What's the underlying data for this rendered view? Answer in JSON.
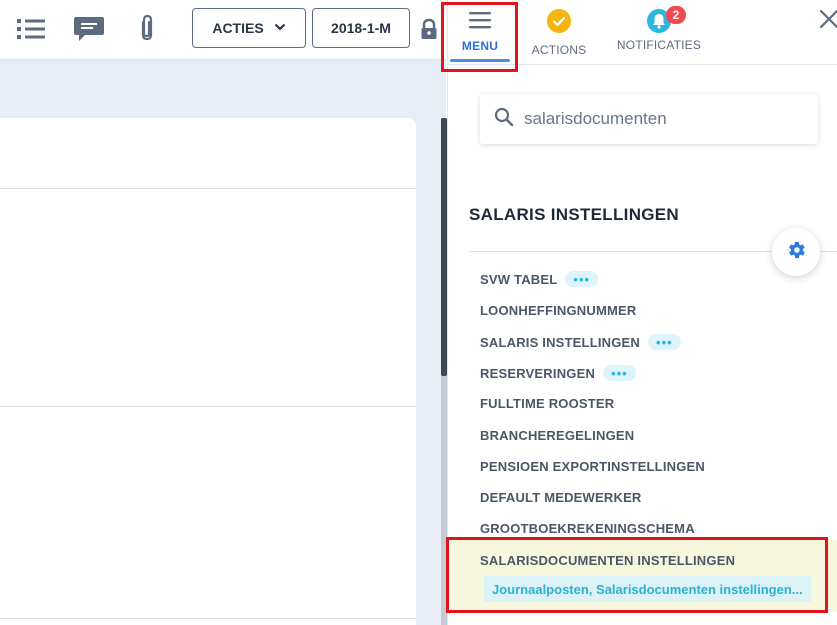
{
  "toolbar": {
    "acties_label": "ACTIES",
    "period_label": "2018-1-M",
    "icons": [
      "list-icon",
      "chat-icon",
      "paperclip-icon",
      "lock-icon"
    ]
  },
  "panel": {
    "tabs": [
      {
        "label": "MENU",
        "icon": "hamburger-icon",
        "active": true
      },
      {
        "label": "ACTIONS",
        "icon": "check-circle-icon",
        "active": false
      },
      {
        "label": "NOTIFICATIES",
        "icon": "bell-icon",
        "active": false,
        "badge": "2"
      }
    ],
    "search": {
      "value": "salarisdocumenten"
    },
    "section_title": "SALARIS INSTELLINGEN",
    "items": [
      {
        "label": "SVW TABEL",
        "dots": "•••"
      },
      {
        "label": "LOONHEFFINGNUMMER"
      },
      {
        "label": "SALARIS INSTELLINGEN",
        "dots": "•••"
      },
      {
        "label": "RESERVERINGEN",
        "dots": "•••"
      },
      {
        "label": "FULLTIME ROOSTER"
      },
      {
        "label": "BRANCHEREGELINGEN"
      },
      {
        "label": "PENSIOEN EXPORTINSTELLINGEN"
      },
      {
        "label": "DEFAULT MEDEWERKER"
      },
      {
        "label": "GROOTBOEKREKENINGSCHEMA"
      },
      {
        "label": "SALARISDOCUMENTEN INSTELLINGEN"
      }
    ],
    "sub_result": "Journaalposten, Salarisdocumenten instellingen..."
  },
  "colors": {
    "accent": "#4a8fe7",
    "highlight": "#e3131b",
    "badge": "#f0494f",
    "check": "#f5b40f"
  }
}
